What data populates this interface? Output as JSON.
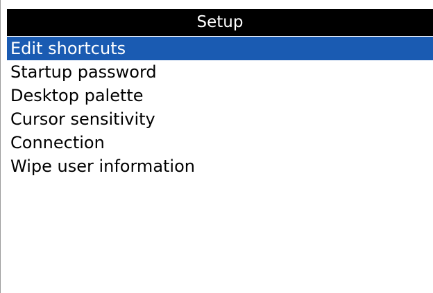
{
  "screen": {
    "title": "Setup",
    "selected_index": 0,
    "menu_items": [
      "Edit shortcuts",
      "Startup password",
      "Desktop palette",
      "Cursor sensitivity",
      "Connection",
      "Wipe user information"
    ]
  },
  "colors": {
    "title_bar_background": "#000000",
    "title_text": "#ffffff",
    "selection_highlight": "#1a5bb2",
    "background": "#ffffff"
  }
}
